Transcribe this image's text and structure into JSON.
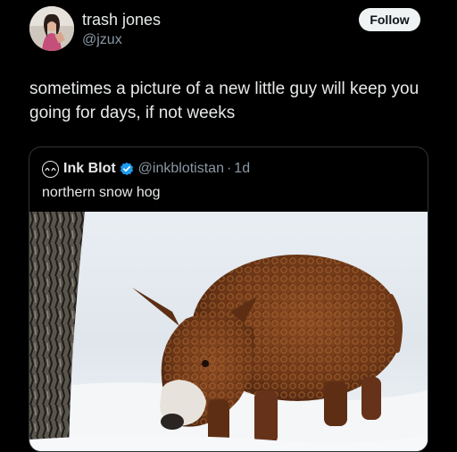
{
  "author": {
    "display_name": "trash jones",
    "handle": "@jzux",
    "avatar": "profile-photo"
  },
  "follow_button": {
    "label": "Follow"
  },
  "tweet": {
    "text": "sometimes a picture of a new little guy will keep you going for days, if not weeks"
  },
  "quoted_tweet": {
    "author_name": "Ink Blot",
    "verified_icon": "verified-badge-icon",
    "handle": "@inkblotistan",
    "separator": "·",
    "time": "1d",
    "text": "northern snow hog",
    "media": {
      "subject": "woolly pig in snow"
    }
  },
  "colors": {
    "background": "#000000",
    "text": "#e7e9ea",
    "secondary_text": "#8b98a5",
    "verified": "#1d9bf0",
    "follow_bg": "#eff3f4"
  }
}
